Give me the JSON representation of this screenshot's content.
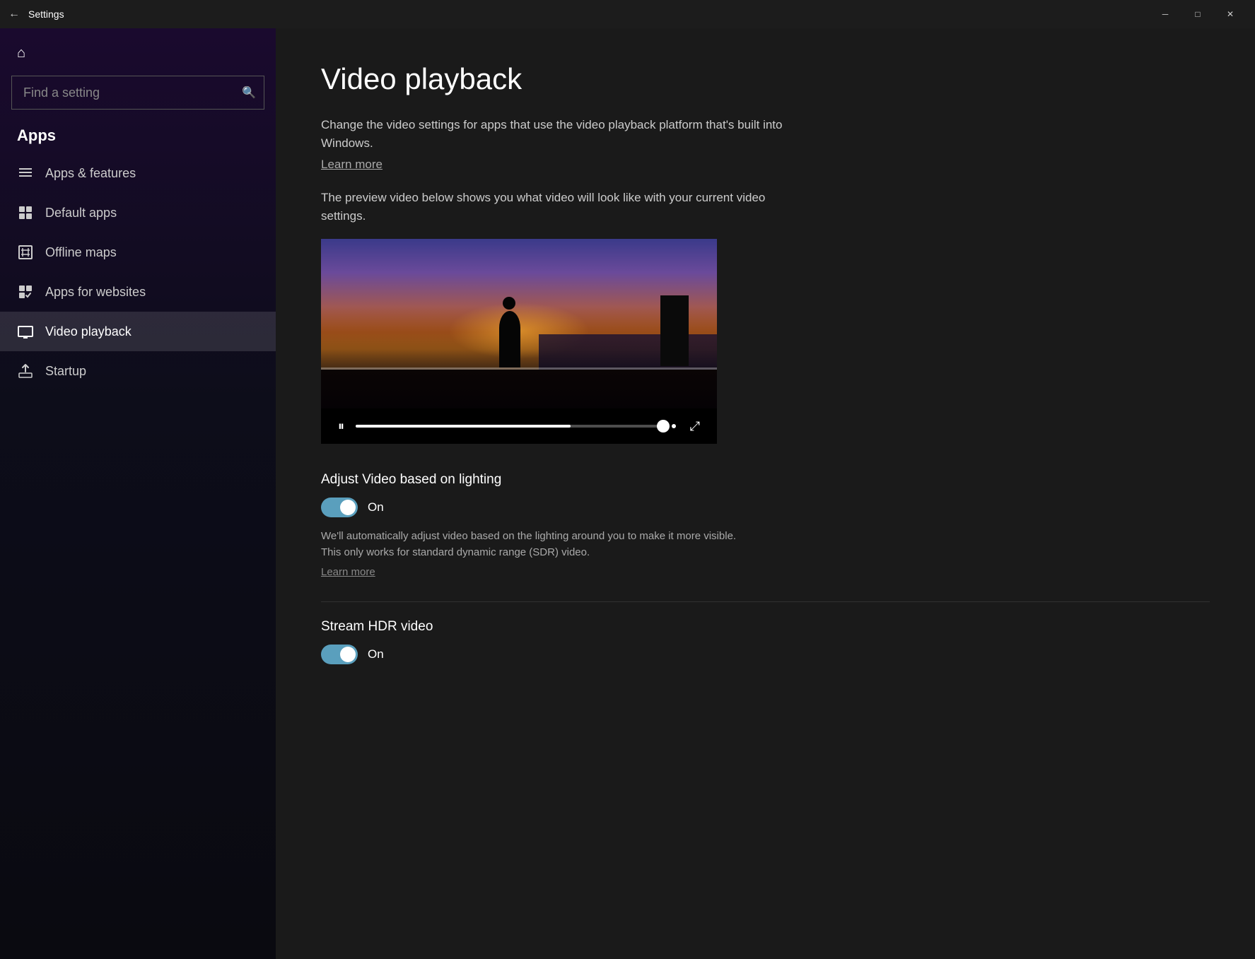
{
  "titlebar": {
    "title": "Settings",
    "back_label": "←",
    "minimize_label": "─",
    "restore_label": "□",
    "close_label": "✕"
  },
  "sidebar": {
    "home_icon": "⌂",
    "search_placeholder": "Find a setting",
    "search_icon": "🔍",
    "section_title": "Apps",
    "nav_items": [
      {
        "id": "apps-features",
        "label": "Apps & features",
        "icon": "☰"
      },
      {
        "id": "default-apps",
        "label": "Default apps",
        "icon": "⊞"
      },
      {
        "id": "offline-maps",
        "label": "Offline maps",
        "icon": "⊡"
      },
      {
        "id": "apps-websites",
        "label": "Apps for websites",
        "icon": "⊠"
      },
      {
        "id": "video-playback",
        "label": "Video playback",
        "icon": "▭",
        "active": true
      },
      {
        "id": "startup",
        "label": "Startup",
        "icon": "⊟"
      }
    ]
  },
  "content": {
    "page_title": "Video playback",
    "description": "Change the video settings for apps that use the video playback platform that's built into Windows.",
    "learn_more_1": "Learn more",
    "preview_text": "The preview video below shows you what video will look like with your current video settings.",
    "video": {
      "progress_pct": 70
    },
    "sections": [
      {
        "id": "adjust-lighting",
        "label": "Adjust Video based on lighting",
        "toggle_state": "On",
        "toggle_on": true,
        "description": "We'll automatically adjust video based on the lighting around you to make it more visible. This only works for standard dynamic range (SDR) video.",
        "learn_more": "Learn more"
      },
      {
        "id": "stream-hdr",
        "label": "Stream HDR video",
        "toggle_state": "On",
        "toggle_on": true,
        "description": "",
        "learn_more": ""
      }
    ]
  }
}
